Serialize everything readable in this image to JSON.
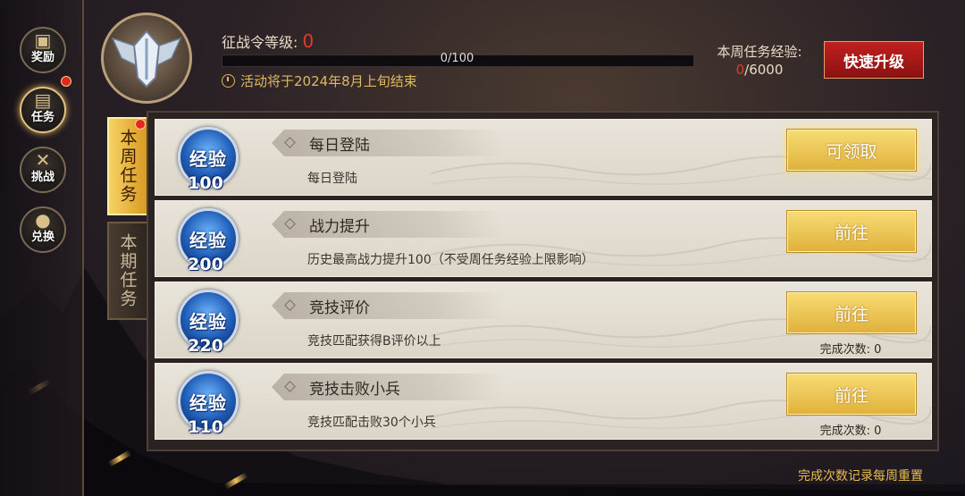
{
  "nav": {
    "items": [
      {
        "label": "奖励",
        "icon": "treasure-chest-icon",
        "active": false,
        "badge": false
      },
      {
        "label": "任务",
        "icon": "book-icon",
        "active": true,
        "badge": true
      },
      {
        "label": "挑战",
        "icon": "crossed-swords-icon",
        "active": false,
        "badge": false
      },
      {
        "label": "兑换",
        "icon": "money-bag-icon",
        "active": false,
        "badge": false
      }
    ]
  },
  "header": {
    "level_label": "征战令等级:",
    "level_value": "0",
    "xp_progress": "0/100",
    "xp_fraction": 0,
    "event_text": "活动将于2024年8月上旬结束",
    "week_xp_label": "本周任务经验:",
    "week_xp_current": "0",
    "week_xp_total": "/6000",
    "quick_upgrade": "快速升级"
  },
  "tabs": [
    {
      "label": "本周任务",
      "active": true
    },
    {
      "label": "本期任务",
      "active": false
    }
  ],
  "tasks": [
    {
      "medal_word": "经验",
      "xp": "100",
      "title": "每日登陆",
      "desc": "每日登陆",
      "action": "可领取",
      "count": ""
    },
    {
      "medal_word": "经验",
      "xp": "200",
      "title": "战力提升",
      "desc": "历史最高战力提升100（不受周任务经验上限影响）",
      "action": "前往",
      "count": ""
    },
    {
      "medal_word": "经验",
      "xp": "220",
      "title": "竞技评价",
      "desc": "竞技匹配获得B评价以上",
      "action": "前往",
      "count": "完成次数: 0"
    },
    {
      "medal_word": "经验",
      "xp": "110",
      "title": "竞技击败小兵",
      "desc": "竞技匹配击败30个小兵",
      "action": "前往",
      "count": "完成次数: 0"
    }
  ],
  "footer_note": "完成次数记录每周重置",
  "colors": {
    "accent_gold": "#e0b03a",
    "red": "#c0201e",
    "level_red": "#e03a2a"
  }
}
